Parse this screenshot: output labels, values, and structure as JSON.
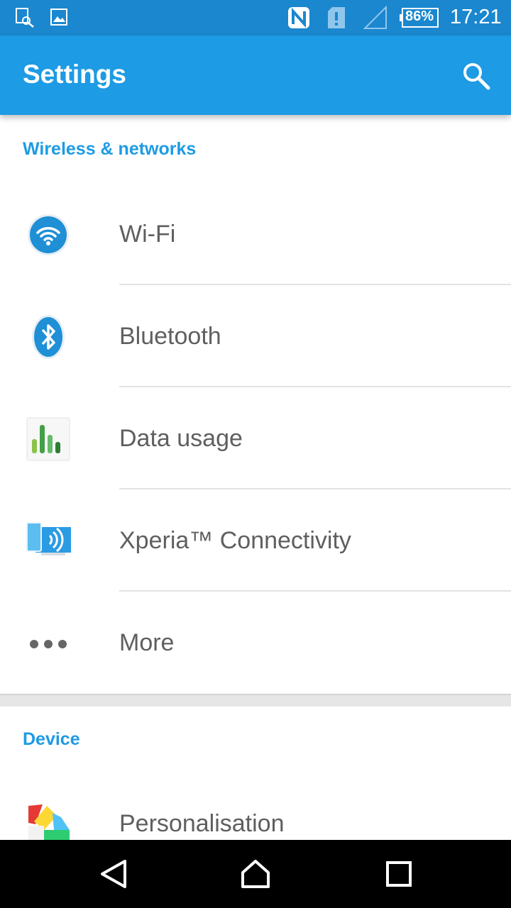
{
  "status_bar": {
    "battery": "86%",
    "time": "17:21",
    "icons": [
      "screenshot-icon",
      "image-icon",
      "nfc-icon",
      "sim-alert-icon",
      "no-signal-icon",
      "battery-icon"
    ]
  },
  "app_bar": {
    "title": "Settings",
    "search_icon": "search-icon"
  },
  "sections": [
    {
      "header": "Wireless & networks",
      "items": [
        {
          "label": "Wi-Fi",
          "icon": "wifi-icon"
        },
        {
          "label": "Bluetooth",
          "icon": "bluetooth-icon"
        },
        {
          "label": "Data usage",
          "icon": "data-usage-icon"
        },
        {
          "label": "Xperia™ Connectivity",
          "icon": "xperia-connectivity-icon"
        },
        {
          "label": "More",
          "icon": "more-icon"
        }
      ]
    },
    {
      "header": "Device",
      "items": [
        {
          "label": "Personalisation",
          "icon": "personalisation-icon"
        }
      ]
    }
  ],
  "nav_bar": {
    "buttons": [
      "back-icon",
      "home-icon",
      "recents-icon"
    ]
  },
  "colors": {
    "status_bar": "#1a87cf",
    "app_bar": "#1d9be4",
    "accent": "#1d9be4",
    "label_text": "#5f5f5f"
  }
}
